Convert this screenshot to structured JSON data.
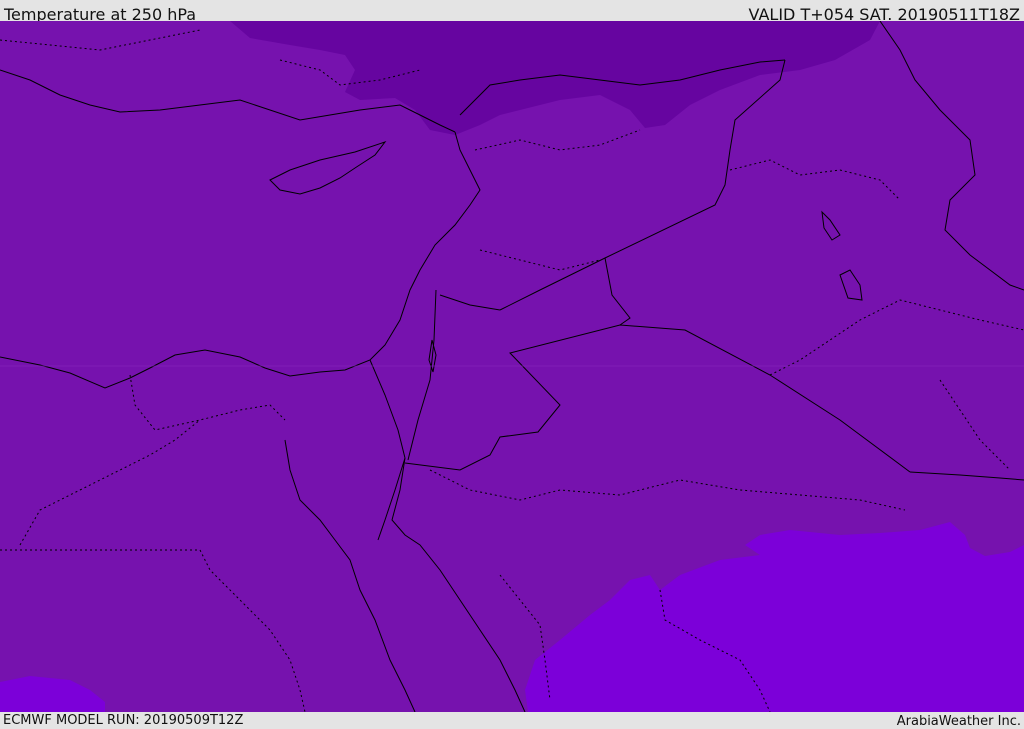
{
  "header": {
    "title": "Temperature at 250 hPa",
    "valid": "VALID T+054 SAT. 20190511T18Z"
  },
  "footer": {
    "model_run": "ECMWF MODEL RUN: 20190509T12Z",
    "credit": "ArabiaWeather Inc."
  },
  "colors": {
    "field_base": "#7612ae",
    "field_cold": "#6605a0",
    "field_warm": "#7c00d9",
    "borders": "#000000"
  }
}
